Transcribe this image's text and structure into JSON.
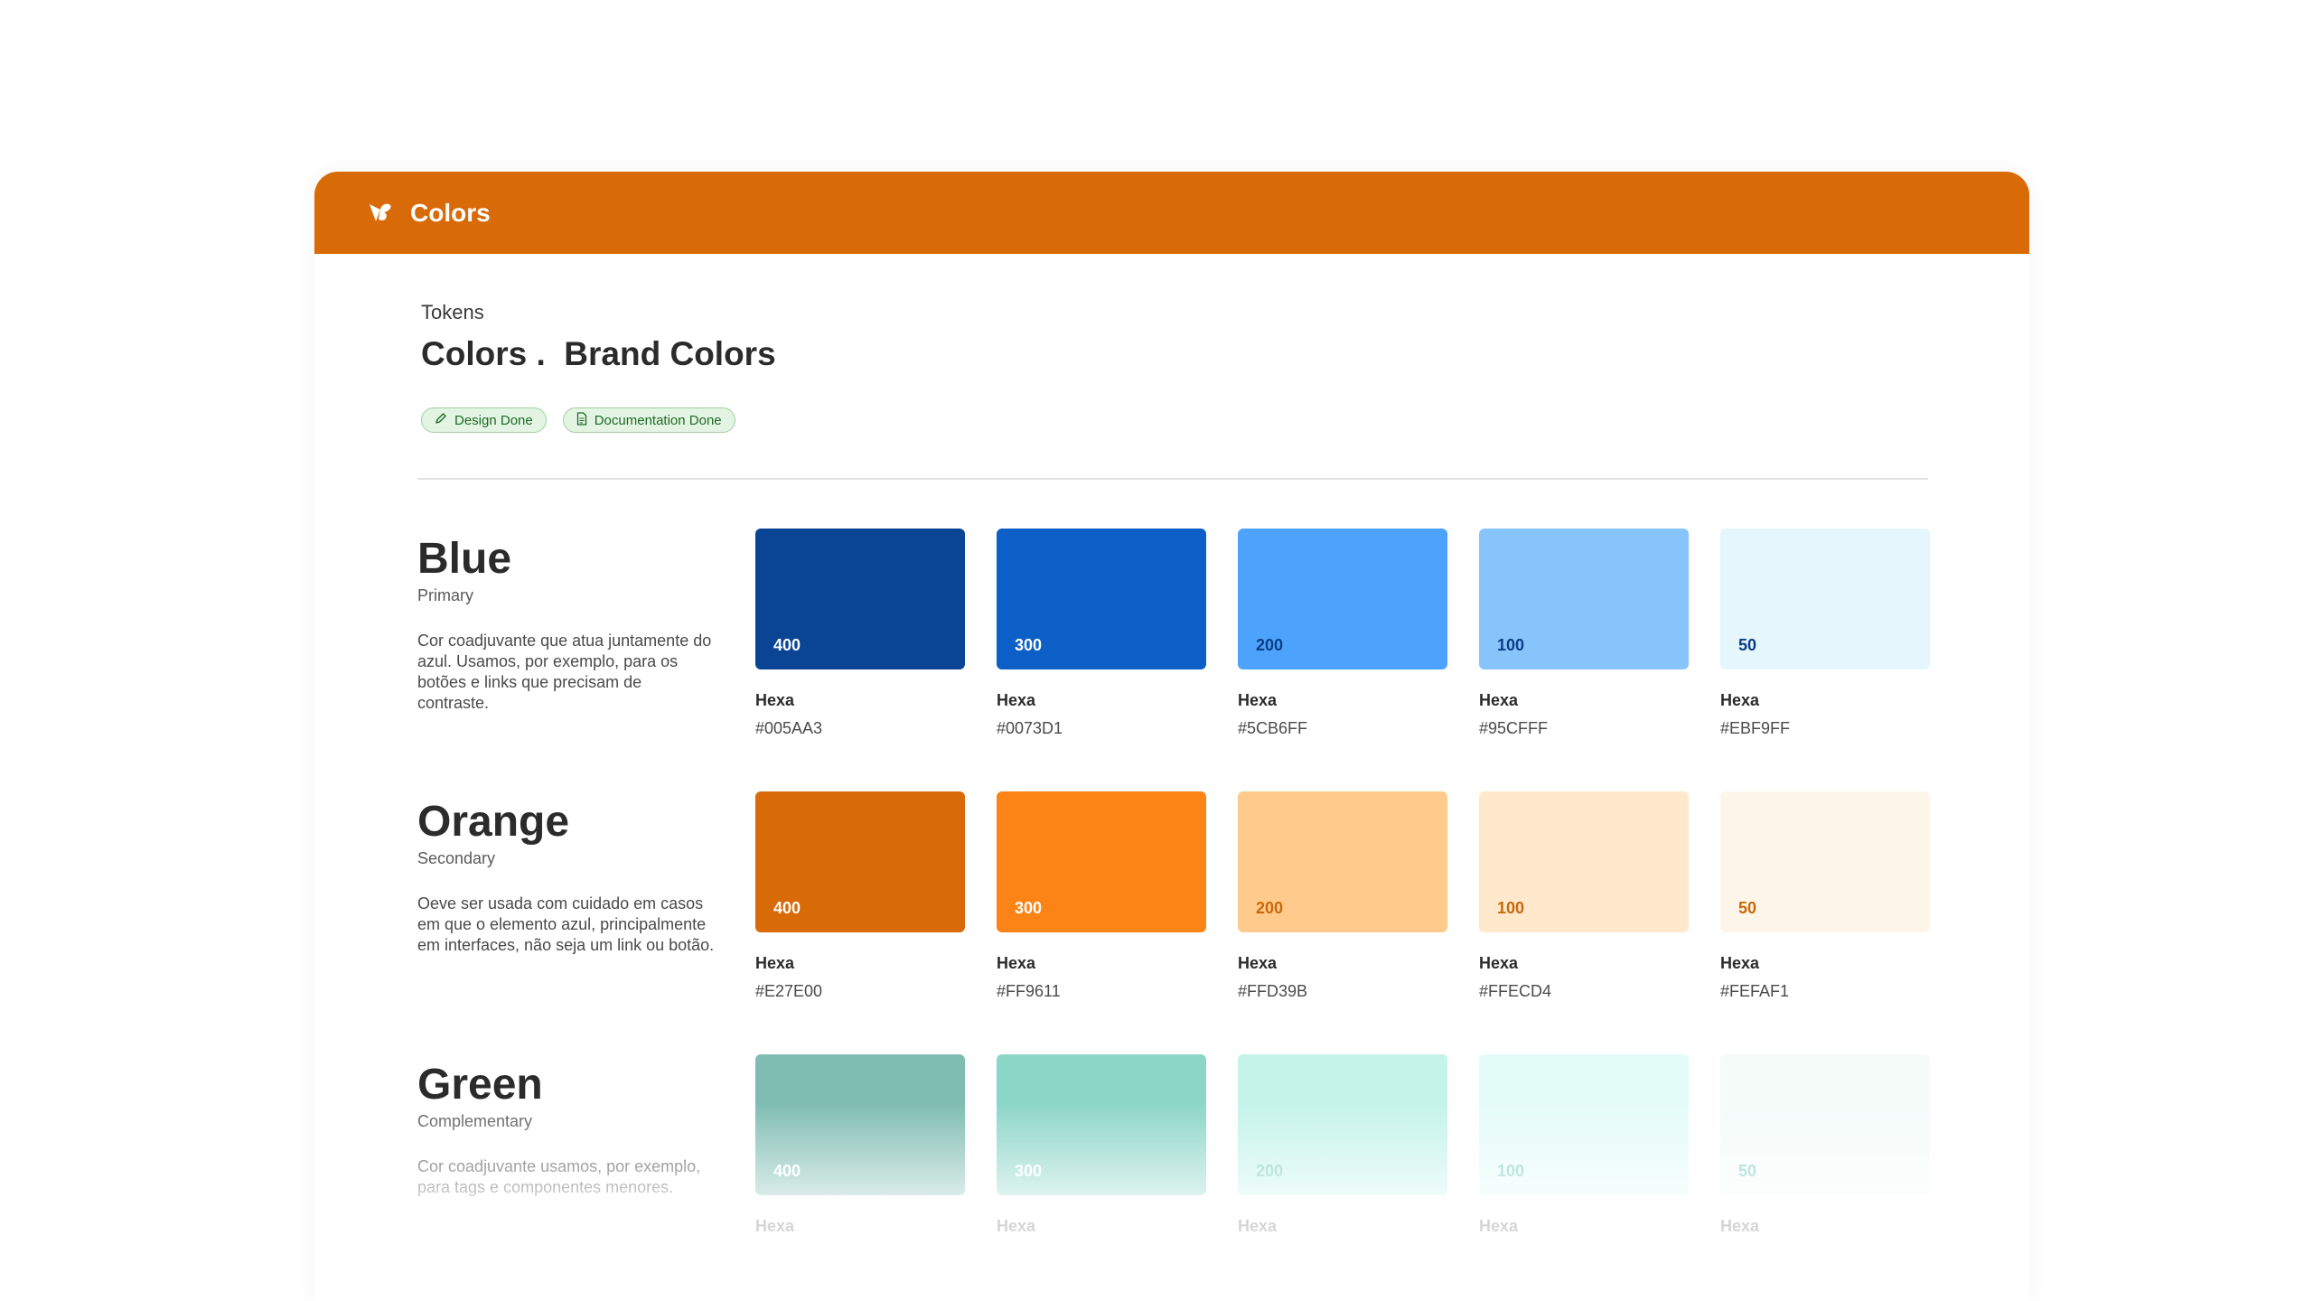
{
  "header": {
    "title": "Colors",
    "logo_icon": "brand-logo-icon",
    "background": "#D96A08"
  },
  "page": {
    "eyebrow": "Tokens",
    "title": "Colors .  Brand Colors",
    "badges": [
      {
        "label": "Design Done",
        "icon": "pencil-icon"
      },
      {
        "label": "Documentation Done",
        "icon": "document-icon"
      }
    ]
  },
  "groups": [
    {
      "name": "Blue",
      "role": "Primary",
      "description": "Cor coadjuvante que atua juntamente do azul. Usamos, por exemplo, para os botões e links que precisam de contraste.",
      "swatches": [
        {
          "shade": "400",
          "hexa_label": "Hexa",
          "hex": "#005AA3",
          "fill": "#0A4595",
          "shade_color": "#FFFFFF"
        },
        {
          "shade": "300",
          "hexa_label": "Hexa",
          "hex": "#0073D1",
          "fill": "#0B5FC7",
          "shade_color": "#FFFFFF"
        },
        {
          "shade": "200",
          "hexa_label": "Hexa",
          "hex": "#5CB6FF",
          "fill": "#4DA3FB",
          "shade_color": "#0A3E86"
        },
        {
          "shade": "100",
          "hexa_label": "Hexa",
          "hex": "#95CFFF",
          "fill": "#88C4FC",
          "shade_color": "#0A3E86"
        },
        {
          "shade": "50",
          "hexa_label": "Hexa",
          "hex": "#EBF9FF",
          "fill": "#E6F6FD",
          "shade_color": "#0A3E86"
        }
      ]
    },
    {
      "name": "Orange",
      "role": "Secondary",
      "description": "Oeve ser usada com cuidado em casos em que o elemento azul, principalmente em interfaces, não seja um link ou botão.",
      "swatches": [
        {
          "shade": "400",
          "hexa_label": "Hexa",
          "hex": "#E27E00",
          "fill": "#D96A08",
          "shade_color": "#FFFFFF"
        },
        {
          "shade": "300",
          "hexa_label": "Hexa",
          "hex": "#FF9611",
          "fill": "#FC8417",
          "shade_color": "#FFFFFF"
        },
        {
          "shade": "200",
          "hexa_label": "Hexa",
          "hex": "#FFD39B",
          "fill": "#FFCB8C",
          "shade_color": "#C8680A"
        },
        {
          "shade": "100",
          "hexa_label": "Hexa",
          "hex": "#FFECD4",
          "fill": "#FFE8CB",
          "shade_color": "#C8680A"
        },
        {
          "shade": "50",
          "hexa_label": "Hexa",
          "hex": "#FEFAF1",
          "fill": "#FDF6E8",
          "shade_color": "#C8680A"
        }
      ]
    },
    {
      "name": "Green",
      "role": "Complementary",
      "description": "Cor coadjuvante usamos, por exemplo, para tags e componentes menores.",
      "swatches": [
        {
          "shade": "400",
          "hexa_label": "Hexa",
          "hex": "",
          "fill": "#7FBDB2",
          "shade_color": "#FFFFFF"
        },
        {
          "shade": "300",
          "hexa_label": "Hexa",
          "hex": "",
          "fill": "#8CD6C8",
          "shade_color": "#FFFFFF"
        },
        {
          "shade": "200",
          "hexa_label": "Hexa",
          "hex": "",
          "fill": "#C4F3EA",
          "shade_color": "#7AC9BA"
        },
        {
          "shade": "100",
          "hexa_label": "Hexa",
          "hex": "",
          "fill": "#E4FCF7",
          "shade_color": "#7AC9BA"
        },
        {
          "shade": "50",
          "hexa_label": "Hexa",
          "hex": "",
          "fill": "#F4FBF9",
          "shade_color": "#7AC9BA"
        }
      ]
    }
  ]
}
